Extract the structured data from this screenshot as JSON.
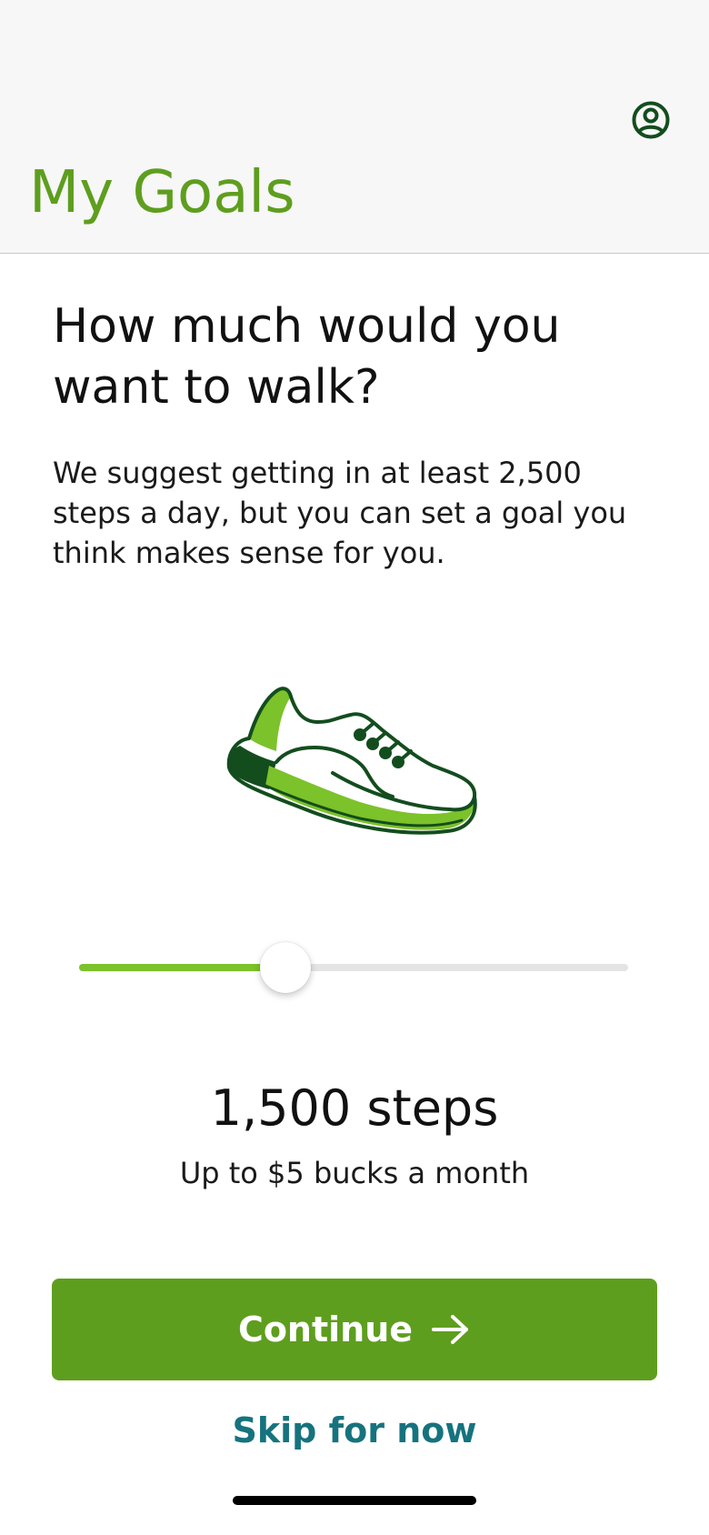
{
  "header": {
    "title": "My Goals",
    "profile_icon": "user-circle-icon"
  },
  "main": {
    "question": "How much would you want to walk?",
    "description": "We suggest getting in at least 2,500 steps a day, but you can set a goal you think makes sense for you.",
    "illustration": "sneaker-icon",
    "slider": {
      "fraction": 0.375
    },
    "steps_value": "1,500 steps",
    "reward_text": "Up to $5 bucks a month"
  },
  "actions": {
    "continue_label": "Continue",
    "continue_icon": "arrow-right-icon",
    "skip_label": "Skip for now"
  },
  "colors": {
    "brand_green": "#5e9e1e",
    "accent_green": "#7cc22a",
    "dark_green": "#134d1e",
    "link_teal": "#16737e",
    "header_bg": "#f7f7f7"
  }
}
